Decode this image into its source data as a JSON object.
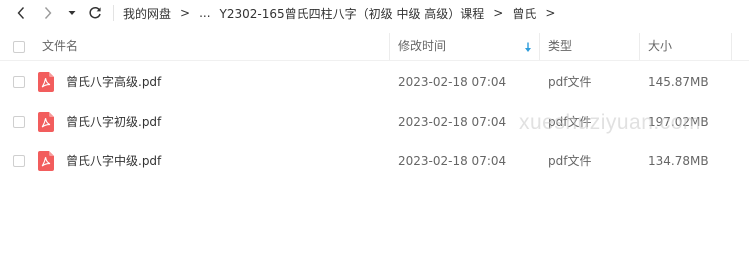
{
  "nav": {
    "back_icon": "chevron-left-icon",
    "forward_icon": "chevron-right-icon",
    "history_icon": "caret-down-icon",
    "reload_icon": "reload-icon"
  },
  "breadcrumb": {
    "items": [
      "我的网盘",
      "...",
      "Y2302-165曾氏四柱八字（初级 中级 高级）课程",
      "曾氏"
    ],
    "separator": ">"
  },
  "table": {
    "columns": {
      "name": "文件名",
      "modified": "修改时间",
      "type": "类型",
      "size": "大小"
    },
    "sort": {
      "column": "modified",
      "direction": "descending",
      "icon": "sort-down-arrow-icon"
    },
    "rows": [
      {
        "name": "曾氏八字高级.pdf",
        "modified": "2023-02-18 07:04",
        "type": "pdf文件",
        "size": "145.87MB",
        "icon": "pdf-file-icon"
      },
      {
        "name": "曾氏八字初级.pdf",
        "modified": "2023-02-18 07:04",
        "type": "pdf文件",
        "size": "197.02MB",
        "icon": "pdf-file-icon"
      },
      {
        "name": "曾氏八字中级.pdf",
        "modified": "2023-02-18 07:04",
        "type": "pdf文件",
        "size": "134.78MB",
        "icon": "pdf-file-icon"
      }
    ]
  },
  "watermark": "xueshuziyuan.com",
  "colors": {
    "pdf_red": "#f25d5d",
    "sort_arrow_blue": "#2d9cdb",
    "text": "#333333",
    "header_text": "#666666"
  }
}
